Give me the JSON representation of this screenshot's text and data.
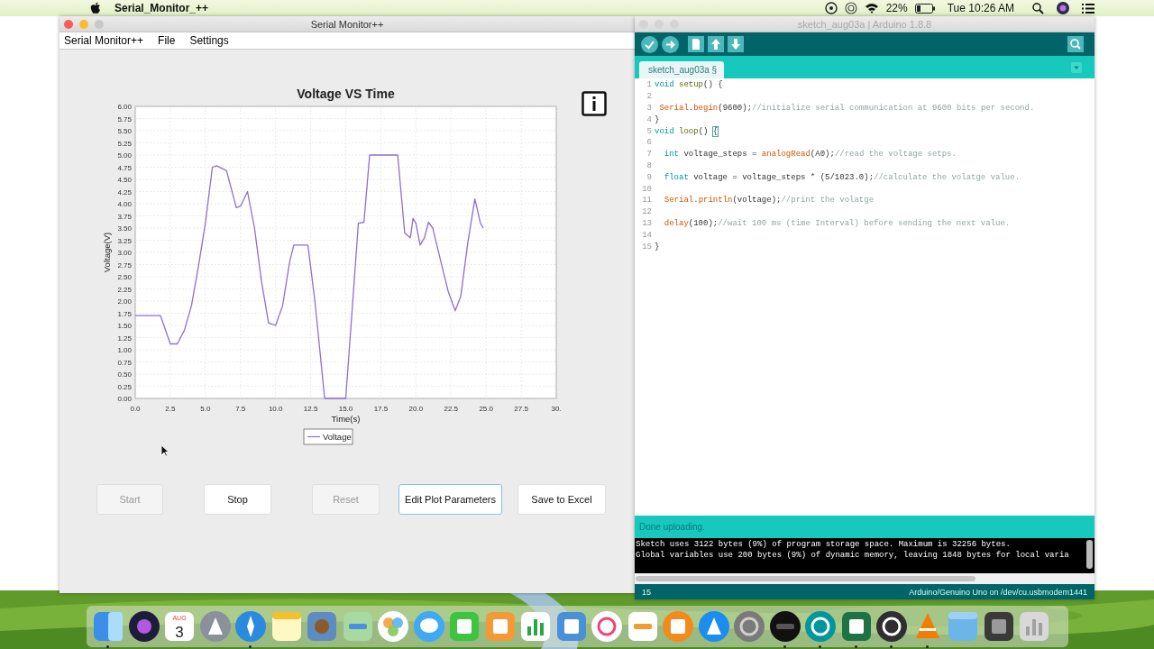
{
  "menu_bar": {
    "app_name": "Serial_Monitor_++",
    "battery_percent": "22%",
    "clock": "Tue 10:26 AM"
  },
  "serial_window": {
    "title": "Serial Monitor++",
    "menu": [
      "Serial Monitor++",
      "File",
      "Settings"
    ],
    "chart_data": {
      "type": "line",
      "grid": true,
      "title": "Voltage VS Time",
      "xlabel": "Time(s)",
      "ylabel": "Voltage(V)",
      "x": [
        0,
        1.8,
        2.5,
        3.0,
        3.5,
        4.0,
        4.5,
        5.0,
        5.5,
        5.8,
        6.5,
        7.2,
        7.5,
        8.0,
        8.5,
        9.0,
        9.5,
        10.0,
        10.5,
        11.0,
        11.3,
        12.3,
        12.8,
        13.5,
        15.0,
        15.5,
        15.9,
        16.3,
        16.7,
        18.7,
        19.2,
        19.6,
        19.8,
        20.0,
        20.3,
        20.6,
        20.9,
        21.2,
        21.7,
        22.3,
        22.8,
        23.2,
        23.7,
        24.2,
        24.6,
        24.8
      ],
      "series": [
        {
          "name": "Voltage",
          "color": "#8e6fd1",
          "values": [
            1.7,
            1.7,
            1.12,
            1.12,
            1.4,
            1.9,
            2.7,
            3.6,
            4.75,
            4.78,
            4.68,
            3.92,
            3.95,
            4.25,
            3.5,
            2.4,
            1.55,
            1.5,
            1.9,
            2.8,
            3.15,
            3.15,
            2.0,
            0,
            0,
            2.0,
            3.6,
            3.62,
            5.0,
            5.0,
            3.4,
            3.3,
            3.7,
            3.6,
            3.15,
            3.3,
            3.62,
            3.5,
            2.9,
            2.2,
            1.8,
            2.1,
            3.2,
            4.1,
            3.6,
            3.5
          ]
        }
      ],
      "xlim": [
        0,
        30
      ],
      "ylim": [
        0,
        6
      ],
      "xticks": [
        {
          "value": 0,
          "label": "0.0"
        },
        {
          "value": 2.5,
          "label": "2.5"
        },
        {
          "value": 5,
          "label": "5.0"
        },
        {
          "value": 7.5,
          "label": "7.5"
        },
        {
          "value": 10,
          "label": "10.0"
        },
        {
          "value": 12.5,
          "label": "12.5"
        },
        {
          "value": 15,
          "label": "15.0"
        },
        {
          "value": 17.5,
          "label": "17.5"
        },
        {
          "value": 20,
          "label": "20.0"
        },
        {
          "value": 22.5,
          "label": "22.5"
        },
        {
          "value": 25,
          "label": "25.0"
        },
        {
          "value": 27.5,
          "label": "27.5"
        },
        {
          "value": 30,
          "label": "30."
        }
      ],
      "yticks": [
        {
          "value": 0,
          "label": "0.00"
        },
        {
          "value": 0.25,
          "label": "0.25"
        },
        {
          "value": 0.5,
          "label": "0.50"
        },
        {
          "value": 0.75,
          "label": "0.75"
        },
        {
          "value": 1,
          "label": "1.00"
        },
        {
          "value": 1.25,
          "label": "1.25"
        },
        {
          "value": 1.5,
          "label": "1.50"
        },
        {
          "value": 1.75,
          "label": "1.75"
        },
        {
          "value": 2,
          "label": "2.00"
        },
        {
          "value": 2.25,
          "label": "2.25"
        },
        {
          "value": 2.5,
          "label": "2.50"
        },
        {
          "value": 2.75,
          "label": "2.75"
        },
        {
          "value": 3,
          "label": "3.00"
        },
        {
          "value": 3.25,
          "label": "3.25"
        },
        {
          "value": 3.5,
          "label": "3.50"
        },
        {
          "value": 3.75,
          "label": "3.75"
        },
        {
          "value": 4,
          "label": "4.00"
        },
        {
          "value": 4.25,
          "label": "4.25"
        },
        {
          "value": 4.5,
          "label": "4.50"
        },
        {
          "value": 4.75,
          "label": "4.75"
        },
        {
          "value": 5,
          "label": "5.00"
        },
        {
          "value": 5.25,
          "label": "5.25"
        },
        {
          "value": 5.5,
          "label": "5.50"
        },
        {
          "value": 5.75,
          "label": "5.75"
        },
        {
          "value": 6,
          "label": "6.00"
        }
      ]
    },
    "buttons": [
      {
        "label": "Start",
        "disabled": true,
        "focused": false
      },
      {
        "label": "Stop",
        "disabled": false,
        "focused": false
      },
      {
        "label": "Reset",
        "disabled": true,
        "focused": false
      },
      {
        "label": "Edit Plot Parameters",
        "disabled": false,
        "focused": true
      },
      {
        "label": "Save to Excel",
        "disabled": false,
        "focused": false
      }
    ]
  },
  "arduino_window": {
    "title": "sketch_aug03a | Arduino 1.8.8",
    "tab": {
      "label": "sketch_aug03a §",
      "selected": true
    },
    "code_lines": [
      {
        "number": "1",
        "segments": [
          {
            "text": "void",
            "kind": "keyword"
          },
          {
            "text": " setup",
            "kind": "structure"
          },
          {
            "text": "() {",
            "kind": "plain"
          }
        ]
      },
      {
        "number": "2"
      },
      {
        "number": "3",
        "segments": [
          {
            "text": " Serial",
            "kind": "function"
          },
          {
            "text": ".",
            "kind": "plain"
          },
          {
            "text": "begin",
            "kind": "function"
          },
          {
            "text": "(9600);",
            "kind": "plain"
          },
          {
            "text": "//initialize serial communication at 9600 bits per second.",
            "kind": "comment"
          }
        ]
      },
      {
        "number": "4",
        "segments": [
          {
            "text": "}",
            "kind": "plain"
          }
        ]
      },
      {
        "number": "5",
        "segments": [
          {
            "text": "void",
            "kind": "keyword"
          },
          {
            "text": " loop",
            "kind": "structure"
          },
          {
            "text": "() ",
            "kind": "plain"
          },
          {
            "text": "{",
            "kind": "matched"
          }
        ]
      },
      {
        "number": "6"
      },
      {
        "number": "7",
        "segments": [
          {
            "text": "  int",
            "kind": "keyword"
          },
          {
            "text": " voltage_steps = ",
            "kind": "plain"
          },
          {
            "text": "analogRead",
            "kind": "function"
          },
          {
            "text": "(A0);",
            "kind": "plain"
          },
          {
            "text": "//read the voltage setps.",
            "kind": "comment"
          }
        ]
      },
      {
        "number": "8"
      },
      {
        "number": "9",
        "segments": [
          {
            "text": "  float",
            "kind": "keyword"
          },
          {
            "text": " voltage = voltage_steps * (5/1023.0);",
            "kind": "plain"
          },
          {
            "text": "//calculate the volatge value.",
            "kind": "comment"
          }
        ]
      },
      {
        "number": "10"
      },
      {
        "number": "11",
        "segments": [
          {
            "text": "  Serial",
            "kind": "function"
          },
          {
            "text": ".",
            "kind": "plain"
          },
          {
            "text": "println",
            "kind": "function"
          },
          {
            "text": "(voltage);",
            "kind": "plain"
          },
          {
            "text": "//print the volatge",
            "kind": "comment"
          }
        ]
      },
      {
        "number": "12"
      },
      {
        "number": "13",
        "segments": [
          {
            "text": "  delay",
            "kind": "function"
          },
          {
            "text": "(100);",
            "kind": "plain"
          },
          {
            "text": "//wait 100 ms (time Interval) before sending the next value.",
            "kind": "comment"
          }
        ]
      },
      {
        "number": "14"
      },
      {
        "number": "15",
        "segments": [
          {
            "text": "}",
            "kind": "plain"
          }
        ]
      }
    ],
    "status": "Done uploading.",
    "console": [
      "Sketch uses 3122 bytes (9%) of program storage space. Maximum is 32256 bytes.",
      "Global variables use 200 bytes (9%) of dynamic memory, leaving 1848 bytes for local varia"
    ],
    "footer_line": "15",
    "footer_board": "Arduino/Genuino Uno on /dev/cu.usbmodem1441"
  },
  "dock": {
    "items": [
      {
        "kind": "finder",
        "running": true
      },
      {
        "kind": "siri",
        "running": false
      },
      {
        "kind": "calendar",
        "running": false,
        "month": "AUG",
        "day": "3"
      },
      {
        "kind": "launchpad",
        "running": false
      },
      {
        "kind": "safari",
        "running": true
      },
      {
        "kind": "notes",
        "running": false
      },
      {
        "kind": "preview",
        "running": false
      },
      {
        "kind": "maps",
        "running": false
      },
      {
        "kind": "photos",
        "running": false
      },
      {
        "kind": "messages",
        "running": false
      },
      {
        "kind": "facetime",
        "running": false
      },
      {
        "kind": "pages",
        "running": false
      },
      {
        "kind": "numbers",
        "running": false
      },
      {
        "kind": "keynote",
        "running": false
      },
      {
        "kind": "music",
        "running": false
      },
      {
        "kind": "reminders",
        "running": false
      },
      {
        "kind": "books",
        "running": false
      },
      {
        "kind": "appstore",
        "running": false
      },
      {
        "kind": "prefs",
        "running": false
      },
      {
        "kind": "serialmonitor",
        "running": true
      },
      {
        "kind": "arduino",
        "running": true
      },
      {
        "kind": "excel",
        "running": true
      },
      {
        "kind": "obs",
        "running": true
      },
      {
        "kind": "vlc",
        "running": true
      },
      {
        "kind": "folder",
        "running": false
      },
      {
        "kind": "screenshot",
        "running": false
      },
      {
        "kind": "trash",
        "running": false
      }
    ]
  }
}
